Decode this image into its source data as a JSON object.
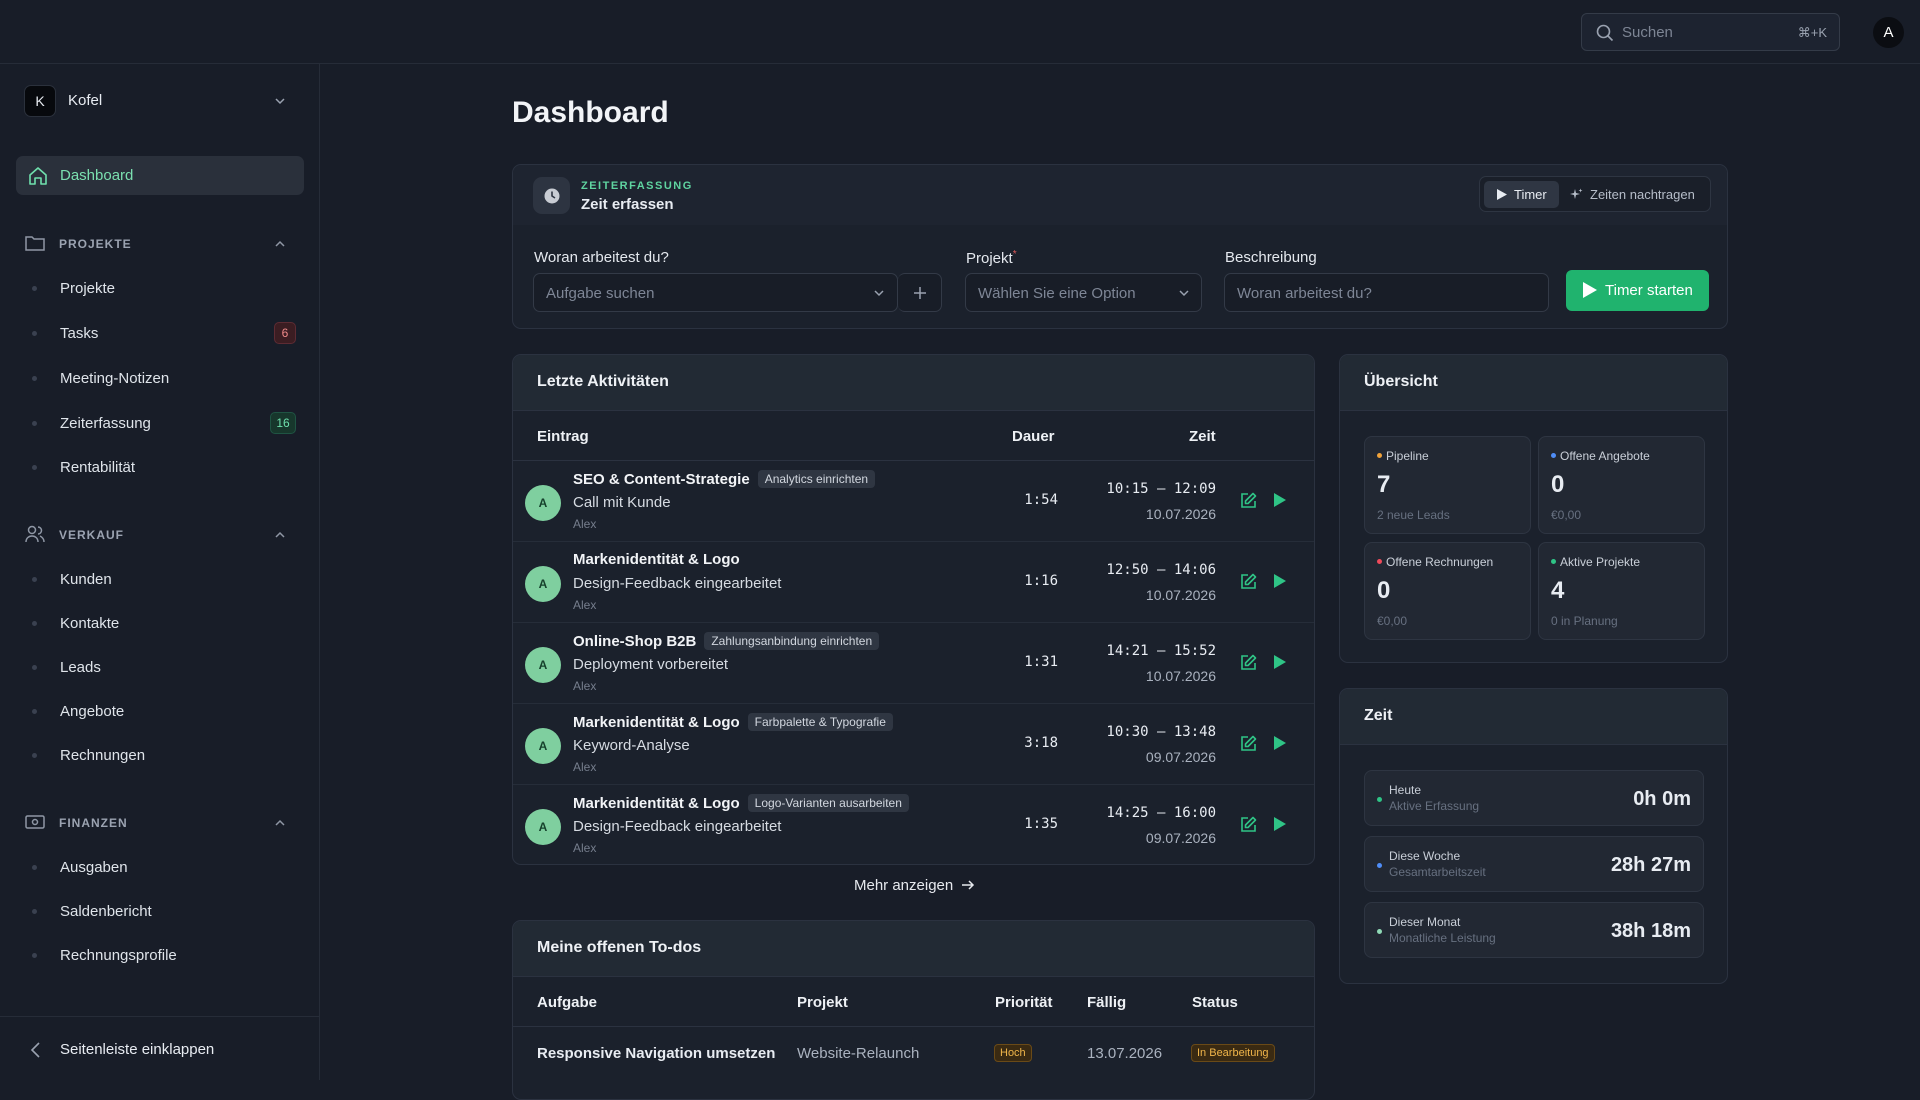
{
  "search": {
    "placeholder": "Suchen",
    "shortcut": "⌘+K"
  },
  "user": {
    "initial": "A"
  },
  "workspace": {
    "initial": "K",
    "name": "Kofel"
  },
  "nav": {
    "dashboard": "Dashboard",
    "sections": [
      {
        "label": "PROJEKTE",
        "items": [
          {
            "label": "Projekte"
          },
          {
            "label": "Tasks",
            "badge": "6"
          },
          {
            "label": "Meeting-Notizen"
          },
          {
            "label": "Zeiterfassung",
            "badge": "16"
          },
          {
            "label": "Rentabilität"
          }
        ]
      },
      {
        "label": "VERKAUF",
        "items": [
          {
            "label": "Kunden"
          },
          {
            "label": "Kontakte"
          },
          {
            "label": "Leads"
          },
          {
            "label": "Angebote"
          },
          {
            "label": "Rechnungen"
          }
        ]
      },
      {
        "label": "FINANZEN",
        "items": [
          {
            "label": "Ausgaben"
          },
          {
            "label": "Saldenbericht"
          },
          {
            "label": "Rechnungsprofile"
          }
        ]
      }
    ],
    "collapse": "Seitenleiste einklappen"
  },
  "page": {
    "title": "Dashboard"
  },
  "time_entry": {
    "overline": "ZEITERFASSUNG",
    "title": "Zeit erfassen",
    "mode_timer": "Timer",
    "mode_backfill": "Zeiten nachtragen",
    "task_label": "Woran arbeitest du?",
    "task_placeholder": "Aufgabe suchen",
    "project_label": "Projekt",
    "project_required": "*",
    "project_placeholder": "Wählen Sie eine Option",
    "desc_label": "Beschreibung",
    "desc_placeholder": "Woran arbeitest du?",
    "start": "Timer starten"
  },
  "activities": {
    "title": "Letzte Aktivitäten",
    "columns": [
      "Eintrag",
      "Dauer",
      "Zeit"
    ],
    "rows": [
      {
        "initial": "A",
        "project": "SEO & Content-Strategie",
        "tag": "Analytics einrichten",
        "desc": "Call mit Kunde",
        "user": "Alex",
        "duration": "1:54",
        "range": "10:15 – 12:09",
        "date": "10.07.2026"
      },
      {
        "initial": "A",
        "project": "Markenidentität & Logo",
        "tag": "",
        "desc": "Design-Feedback eingearbeitet",
        "user": "Alex",
        "duration": "1:16",
        "range": "12:50 – 14:06",
        "date": "10.07.2026"
      },
      {
        "initial": "A",
        "project": "Online-Shop B2B",
        "tag": "Zahlungsanbindung einrichten",
        "desc": "Deployment vorbereitet",
        "user": "Alex",
        "duration": "1:31",
        "range": "14:21 – 15:52",
        "date": "10.07.2026"
      },
      {
        "initial": "A",
        "project": "Markenidentität & Logo",
        "tag": "Farbpalette & Typografie",
        "desc": "Keyword-Analyse",
        "user": "Alex",
        "duration": "3:18",
        "range": "10:30 – 13:48",
        "date": "09.07.2026"
      },
      {
        "initial": "A",
        "project": "Markenidentität & Logo",
        "tag": "Logo-Varianten ausarbeiten",
        "desc": "Design-Feedback eingearbeitet",
        "user": "Alex",
        "duration": "1:35",
        "range": "14:25 – 16:00",
        "date": "09.07.2026"
      }
    ],
    "more": "Mehr anzeigen"
  },
  "todos": {
    "title": "Meine offenen To-dos",
    "columns": [
      "Aufgabe",
      "Projekt",
      "Priorität",
      "Fällig",
      "Status"
    ],
    "rows": [
      {
        "task": "Responsive Navigation umsetzen",
        "project": "Website-Relaunch",
        "priority": "Hoch",
        "due": "13.07.2026",
        "status": "In Bearbeitung"
      }
    ]
  },
  "overview": {
    "title": "Übersicht",
    "kpis": [
      {
        "label": "Pipeline",
        "value": "7",
        "sub": "2 neue Leads",
        "color": "#f0a23a"
      },
      {
        "label": "Offene Angebote",
        "value": "0",
        "sub": "€0,00",
        "color": "#4f8df7"
      },
      {
        "label": "Offene Rechnungen",
        "value": "0",
        "sub": "€0,00",
        "color": "#ef4a5a"
      },
      {
        "label": "Aktive Projekte",
        "value": "4",
        "sub": "0 in Planung",
        "color": "#2fc486"
      }
    ]
  },
  "time": {
    "title": "Zeit",
    "rows": [
      {
        "label": "Heute",
        "sub": "Aktive Erfassung",
        "value": "0h 0m",
        "color": "#2fc486"
      },
      {
        "label": "Diese Woche",
        "sub": "Gesamtarbeitszeit",
        "value": "28h 27m",
        "color": "#4f8df7"
      },
      {
        "label": "Dieser Monat",
        "sub": "Monatliche Leistung",
        "value": "38h 18m",
        "color": "#8fd9b6"
      }
    ]
  },
  "colors": {
    "accent": "#20b36e",
    "background": "#181d28"
  }
}
